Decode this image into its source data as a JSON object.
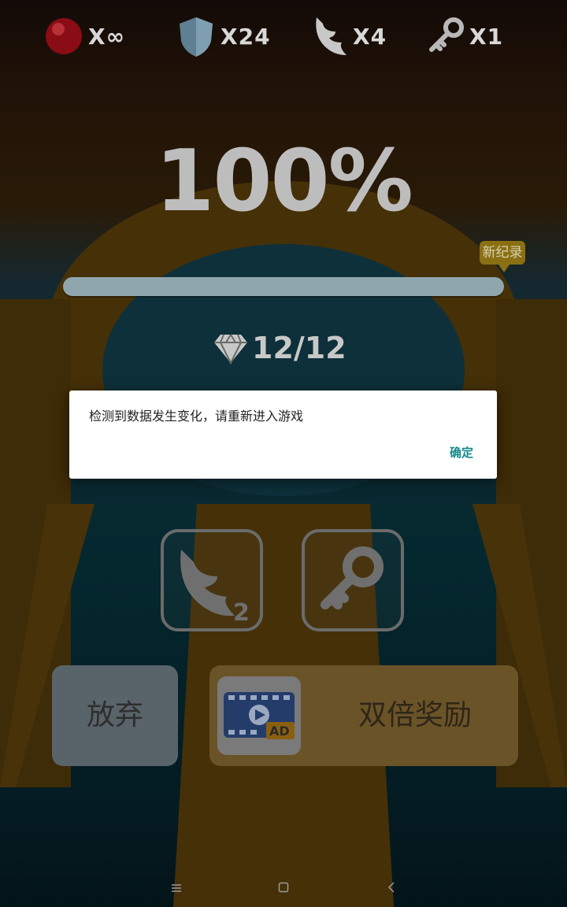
{
  "hud": {
    "lives": {
      "icon": "red-ball-icon",
      "count": "X∞"
    },
    "shields": {
      "icon": "shield-icon",
      "count": "X24"
    },
    "wings": {
      "icon": "wing-icon",
      "count": "X4"
    },
    "keys": {
      "icon": "key-icon",
      "count": "X1"
    }
  },
  "progress": {
    "label": "100%",
    "fill": 1.0,
    "record_badge": "新纪录"
  },
  "gems": {
    "icon": "diamond-icon",
    "count": "12/12"
  },
  "powerups": [
    {
      "icon": "wing-icon",
      "subscript": "2"
    },
    {
      "icon": "key-icon"
    }
  ],
  "actions": {
    "give_up": "放弃",
    "double_reward": "双倍奖励",
    "ad_icon": "video-ad-icon",
    "ad_badge": "AD"
  },
  "dialog": {
    "message": "检测到数据发生变化，请重新进入游戏",
    "confirm": "确定"
  },
  "navbar": {
    "menu": "menu-icon",
    "home": "home-icon",
    "back": "back-icon"
  },
  "colors": {
    "dialog_accent": "#138a8a",
    "record_badge": "#8a7012",
    "give_up_button": "#59636a",
    "double_reward_button": "#6b5328"
  }
}
